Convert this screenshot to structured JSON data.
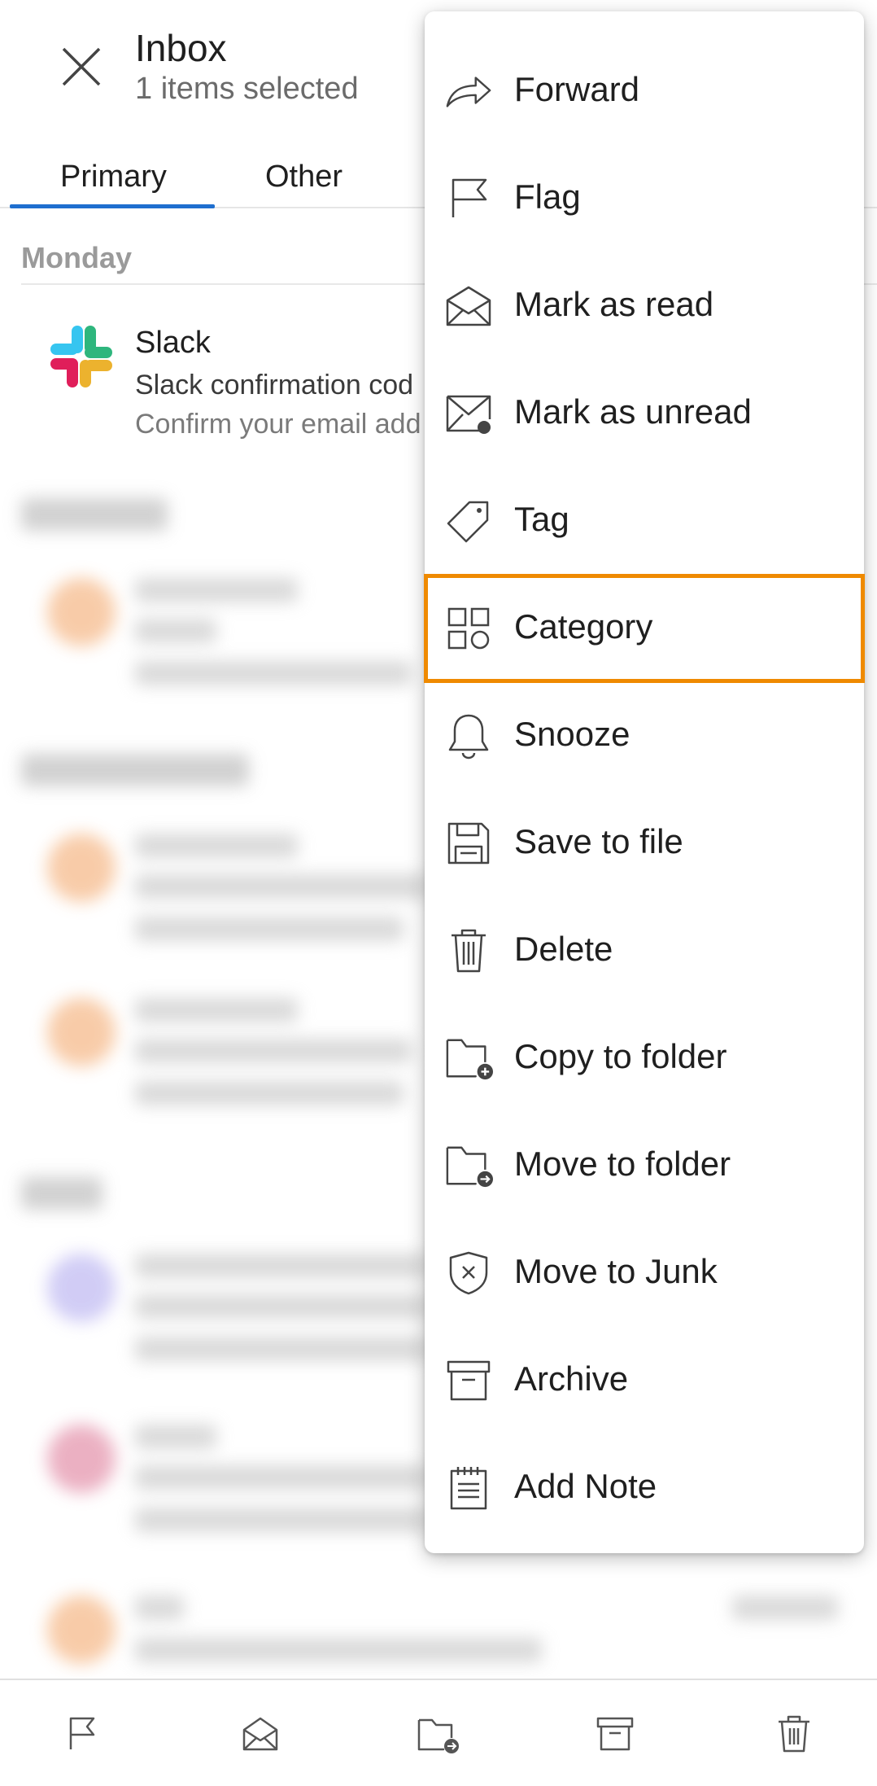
{
  "header": {
    "title": "Inbox",
    "subtitle": "1 items selected"
  },
  "tabs": [
    {
      "label": "Primary",
      "active": true
    },
    {
      "label": "Other",
      "active": false
    }
  ],
  "section": {
    "label": "Monday"
  },
  "message": {
    "sender": "Slack",
    "subject": "Slack confirmation cod",
    "preview": "Confirm your email add"
  },
  "menu": {
    "items": [
      {
        "label": "Forward",
        "icon": "forward-icon"
      },
      {
        "label": "Flag",
        "icon": "flag-icon"
      },
      {
        "label": "Mark as read",
        "icon": "envelope-open-icon"
      },
      {
        "label": "Mark as unread",
        "icon": "envelope-unread-icon"
      },
      {
        "label": "Tag",
        "icon": "tag-icon"
      },
      {
        "label": "Category",
        "icon": "category-icon",
        "highlighted": true
      },
      {
        "label": "Snooze",
        "icon": "bell-icon"
      },
      {
        "label": "Save to file",
        "icon": "save-icon"
      },
      {
        "label": "Delete",
        "icon": "trash-icon"
      },
      {
        "label": "Copy to folder",
        "icon": "folder-copy-icon"
      },
      {
        "label": "Move to folder",
        "icon": "folder-move-icon"
      },
      {
        "label": "Move to Junk",
        "icon": "junk-shield-icon"
      },
      {
        "label": "Archive",
        "icon": "archive-icon"
      },
      {
        "label": "Add Note",
        "icon": "note-icon"
      }
    ]
  },
  "toolbar": {
    "items": [
      "flag-icon",
      "envelope-open-icon",
      "folder-move-icon",
      "archive-icon",
      "trash-icon"
    ]
  },
  "colors": {
    "accent": "#1f6fcf",
    "highlight": "#ef8a00"
  }
}
